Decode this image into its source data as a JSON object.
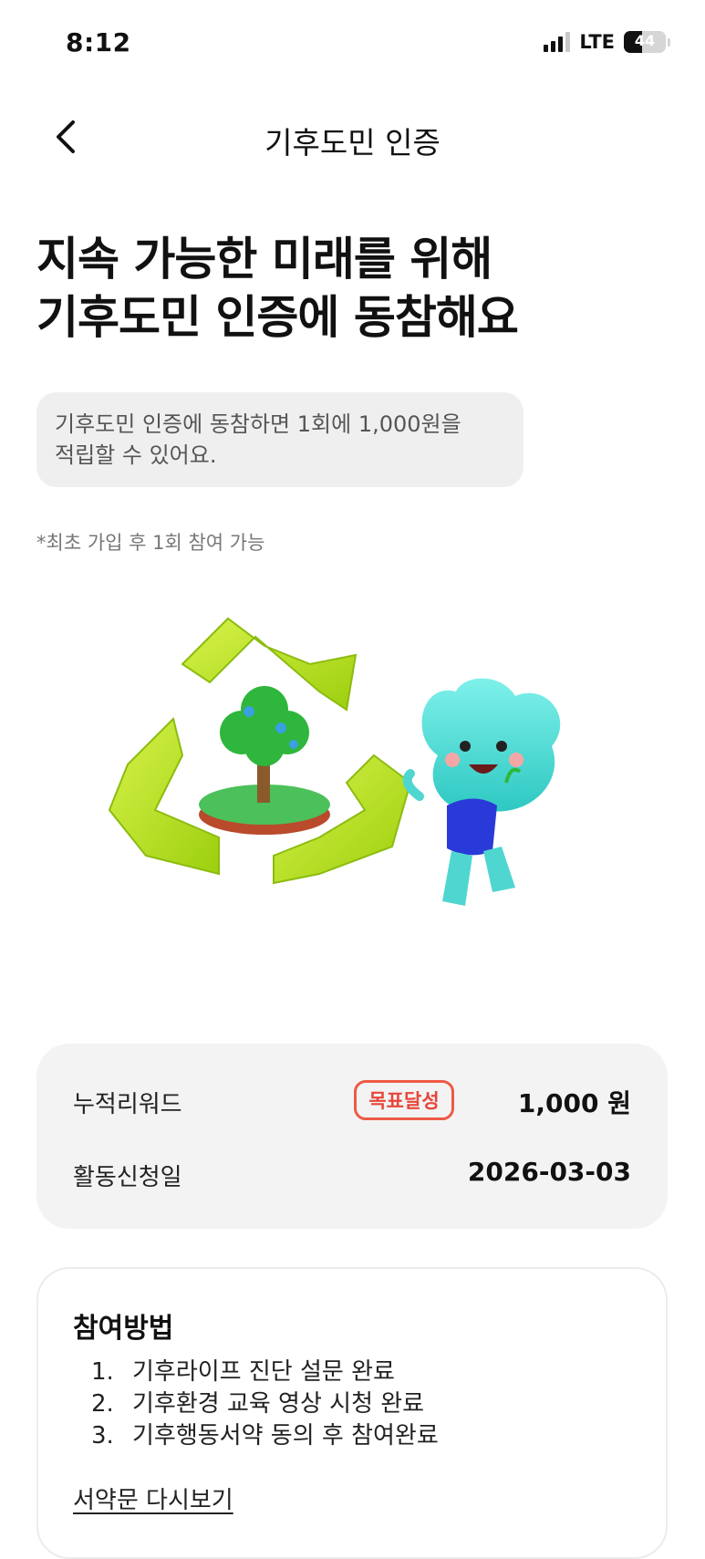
{
  "status": {
    "time": "8:12",
    "network": "LTE",
    "battery": "44"
  },
  "header": {
    "title": "기후도민 인증",
    "back_icon": "chevron-left-icon"
  },
  "hero": {
    "line1": "지속 가능한 미래를 위해",
    "line2": "기후도민 인증에 동참해요",
    "notice_line1": "기후도민 인증에 동참하면 1회에 1,000원을",
    "notice_line2": "적립할 수 있어요.",
    "footnote": "*최초 가입 후 1회 참여 가능"
  },
  "summary": {
    "reward_label": "누적리워드",
    "badge": "목표달성",
    "reward_value": "1,000 원",
    "date_label": "활동신청일",
    "date_value": "2026-03-03"
  },
  "method": {
    "title": "참여방법",
    "steps": [
      {
        "num": "1.",
        "text": "기후라이프 진단 설문 완료"
      },
      {
        "num": "2.",
        "text": "기후환경 교육 영상 시청 완료"
      },
      {
        "num": "3.",
        "text": "기후행동서약 동의 후 참여완료"
      }
    ],
    "link": "서약문 다시보기"
  },
  "colors": {
    "accent_red": "#ee5a45",
    "card_bg": "#f3f3f3",
    "arrow_green": "#b8e21a",
    "mascot": "#4fd6d0"
  }
}
